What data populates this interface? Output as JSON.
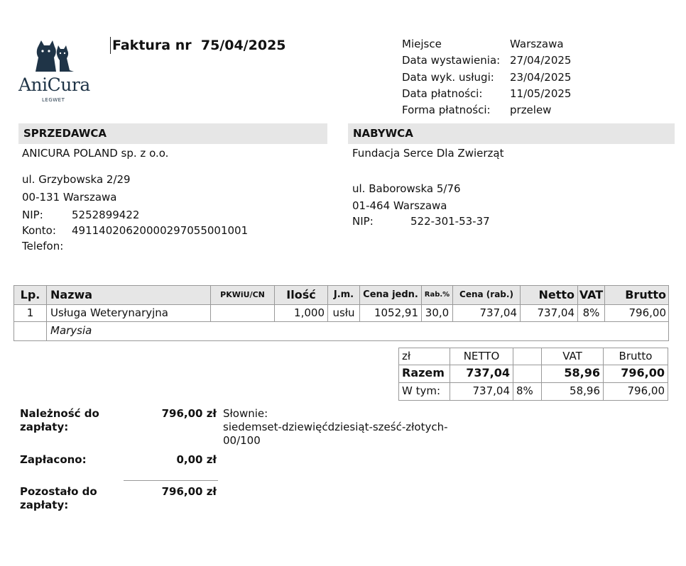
{
  "logo": {
    "icon_name": "cats-logo-icon",
    "brand": "AniCura",
    "sub": "LEGWET",
    "color": "#1f3447"
  },
  "invoice": {
    "title": "Faktura nr  75/04/2025"
  },
  "meta": [
    {
      "label": "Miejsce",
      "value": "Warszawa"
    },
    {
      "label": "Data wystawienia:",
      "value": "27/04/2025"
    },
    {
      "label": "Data wyk. usługi:",
      "value": "23/04/2025"
    },
    {
      "label": "Data płatności:",
      "value": "11/05/2025"
    },
    {
      "label": "Forma płatności:",
      "value": "przelew"
    }
  ],
  "seller": {
    "header": "SPRZEDAWCA",
    "name": "ANICURA POLAND sp. z o.o.",
    "street": "ul. Grzybowska 2/29",
    "city": "00-131 Warszawa",
    "nip_label": "NIP:",
    "nip": "5252899422",
    "account_label": "Konto:",
    "account": "49114020620000297055001001",
    "phone_label": "Telefon:"
  },
  "buyer": {
    "header": "NABYWCA",
    "name": "Fundacja Serce Dla Zwierząt",
    "street": "ul. Baborowska 5/76",
    "city": "01-464 Warszawa",
    "nip_label": "NIP:",
    "nip": "522-301-53-37"
  },
  "items": {
    "columns": {
      "lp": "Lp.",
      "nazwa": "Nazwa",
      "pkwiu": "PKWiU/CN",
      "ilosc": "Ilość",
      "jm": "J.m.",
      "cena_jedn": "Cena jedn.",
      "rabat": "Rab.%",
      "cena_rab": "Cena (rab.)",
      "netto": "Netto",
      "vat": "VAT",
      "brutto": "Brutto"
    },
    "rows": [
      {
        "lp": "1",
        "nazwa": "Usługa Weterynaryjna",
        "pkwiu": "",
        "ilosc": "1,000",
        "jm": "usłu",
        "cena_jedn": "1052,91",
        "rabat": "30,0",
        "cena_rab": "737,04",
        "netto": "737,04",
        "vat": "8%",
        "brutto": "796,00",
        "note": "Marysia"
      }
    ]
  },
  "summary": {
    "header": {
      "currency": "zł",
      "netto": "NETTO",
      "vat": "VAT",
      "brutto": "Brutto"
    },
    "total": {
      "label": "Razem",
      "netto": "737,04",
      "vat": "58,96",
      "brutto": "796,00"
    },
    "breakdown": {
      "label": "W tym:",
      "netto": "737,04",
      "rate": "8%",
      "vat": "58,96",
      "brutto": "796,00"
    }
  },
  "payment": {
    "due_label": "Należność do zapłaty:",
    "due_value": "796,00 zł",
    "words_label": "Słownie:",
    "words_value": "siedemset-dziewięćdziesiąt-sześć-złotych-00/100",
    "paid_label": "Zapłacono:",
    "paid_value": "0,00 zł",
    "remaining_label": "Pozostało do zapłaty:",
    "remaining_value": "796,00 zł"
  }
}
